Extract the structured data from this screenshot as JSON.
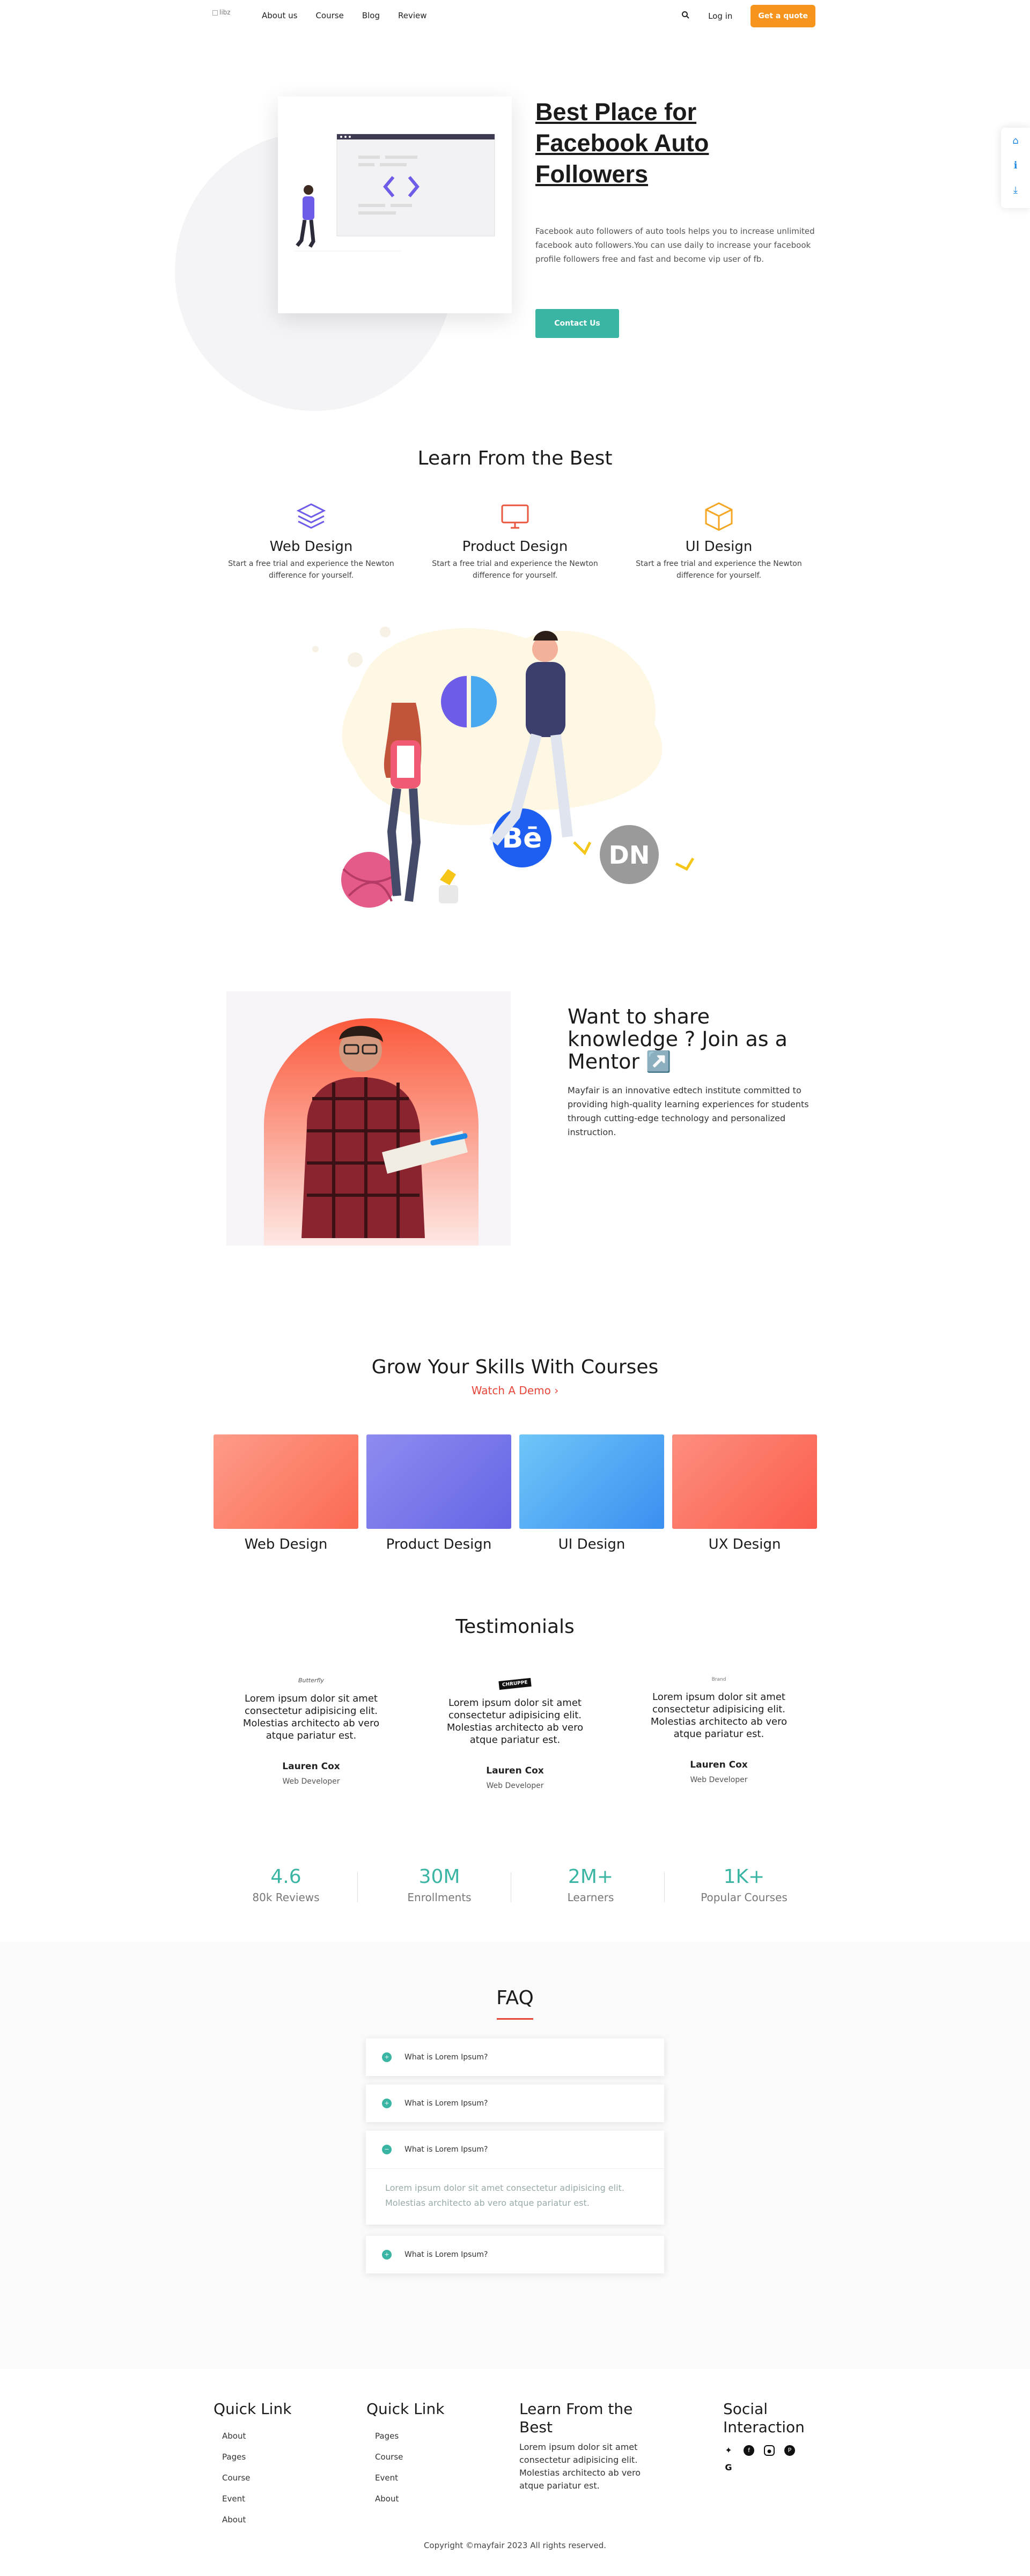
{
  "nav": {
    "logo_alt": "libz",
    "links": [
      "About us",
      "Course",
      "Blog",
      "Review"
    ],
    "login": "Log in",
    "cta": "Get a quote"
  },
  "hero": {
    "title": "Best Place for Facebook Auto Followers",
    "description": "Facebook auto followers of auto tools helps you to increase unlimited facebook auto followers.You can use daily to increase your facebook profile followers free and fast and become vip user of fb.",
    "button": "Contact Us"
  },
  "learn": {
    "title": "Learn From the Best",
    "features": [
      {
        "title": "Web Design",
        "desc": "Start a free trial and experience the Newton difference for yourself.",
        "icon": "layers-icon",
        "color": "#6c5ce7"
      },
      {
        "title": "Product Design",
        "desc": "Start a free trial and experience the Newton difference for yourself.",
        "icon": "monitor-icon",
        "color": "#e8563f"
      },
      {
        "title": "UI Design",
        "desc": "Start a free trial and experience the Newton difference for yourself.",
        "icon": "box-icon",
        "color": "#f5a623"
      }
    ]
  },
  "illustration": {
    "badges": [
      "Bē",
      "DN"
    ]
  },
  "mentor": {
    "title": "Want to share knowledge ? Join as a Mentor ↗️",
    "description": "Mayfair is an innovative edtech institute committed to providing high-quality learning experiences for students through cutting-edge technology and personalized instruction."
  },
  "courses": {
    "title": "Grow Your Skills With Courses",
    "demo_link": "Watch A Demo ›",
    "items": [
      {
        "label": "Web Design",
        "color": "#fb7a64"
      },
      {
        "label": "Product Design",
        "color": "#7c79eb"
      },
      {
        "label": "UI Design",
        "color": "#4aa8f0"
      },
      {
        "label": "UX Design",
        "color": "#fb7364"
      }
    ]
  },
  "testimonials": {
    "title": "Testimonials",
    "items": [
      {
        "logo": "Butterfly",
        "quote": "Lorem ipsum dolor sit amet consectetur adipisicing elit. Molestias architecto ab vero atque pariatur est.",
        "name": "Lauren Cox",
        "role": "Web Developer"
      },
      {
        "logo": "CHRUPPE",
        "quote": "Lorem ipsum dolor sit amet consectetur adipisicing elit. Molestias architecto ab vero atque pariatur est.",
        "name": "Lauren Cox",
        "role": "Web Developer"
      },
      {
        "logo": "Brand",
        "quote": "Lorem ipsum dolor sit amet consectetur adipisicing elit. Molestias architecto ab vero atque pariatur est.",
        "name": "Lauren Cox",
        "role": "Web Developer"
      }
    ]
  },
  "stats": [
    {
      "num": "4.6",
      "label": "80k Reviews"
    },
    {
      "num": "30M",
      "label": "Enrollments"
    },
    {
      "num": "2M+",
      "label": "Learners"
    },
    {
      "num": "1K+",
      "label": "Popular Courses"
    }
  ],
  "faq": {
    "title": "FAQ",
    "items": [
      {
        "q": "What is Lorem Ipsum?"
      },
      {
        "q": "What is Lorem Ipsum?"
      },
      {
        "q": "What is Lorem Ipsum?",
        "a": "Lorem ipsum dolor sit amet consectetur adipisicing elit. Molestias architecto ab vero atque pariatur est."
      },
      {
        "q": "What is Lorem Ipsum?"
      }
    ]
  },
  "footer": {
    "col1": {
      "title": "Quick Link",
      "links": [
        "About",
        "Pages",
        "Course",
        "Event",
        "About"
      ]
    },
    "col2": {
      "title": "Quick Link",
      "links": [
        "Pages",
        "Course",
        "Event",
        "About"
      ]
    },
    "col3": {
      "title": "Learn From the Best",
      "text": "Lorem ipsum dolor sit amet consectetur adipisicing elit. Molestias architecto ab vero atque pariatur est."
    },
    "col4": {
      "title": "Social Interaction"
    },
    "copyright": "Copyright ©mayfair 2023 All rights reserved."
  }
}
